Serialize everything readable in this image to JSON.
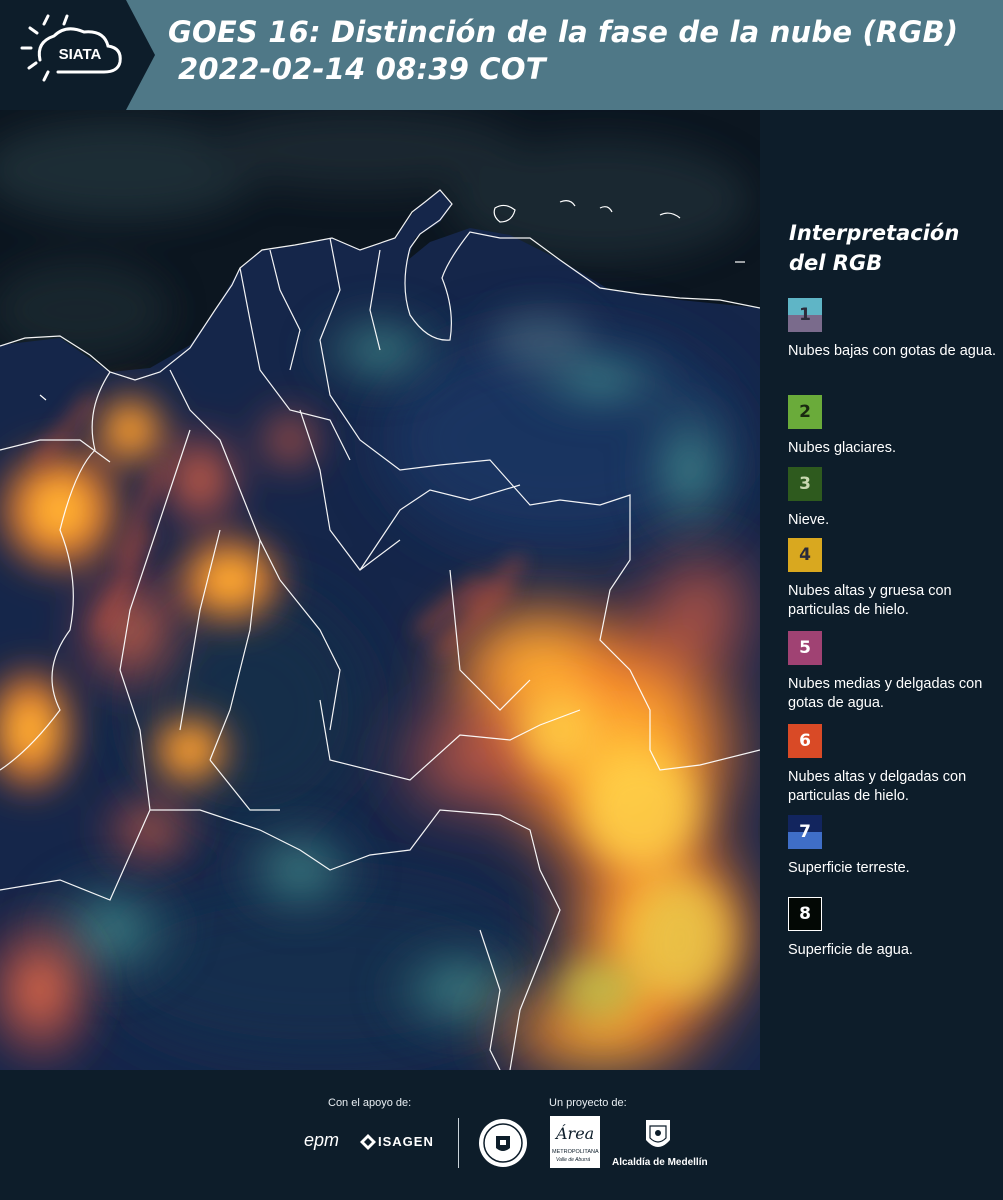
{
  "header": {
    "logo_text": "SIATA",
    "title_line1": "GOES 16: Distinción de la fase de la nube (RGB)",
    "title_line2": "2022-02-14 08:39 COT",
    "bg_color": "#4f7887"
  },
  "legend": {
    "title": "Interpretación del RGB",
    "items": [
      {
        "number": "1",
        "label": "Nubes bajas con gotas de agua.",
        "color_top": "#5fb5c6",
        "color_bottom": "#7a6b8c"
      },
      {
        "number": "2",
        "label": "Nubes glaciares.",
        "color": "#6aab3a"
      },
      {
        "number": "3",
        "label": "Nieve.",
        "color": "#2e5a1e"
      },
      {
        "number": "4",
        "label": "Nubes altas y gruesa con particulas de hielo.",
        "color": "#d9a81f"
      },
      {
        "number": "5",
        "label": "Nubes medias y delgadas con gotas de agua.",
        "color": "#a04273"
      },
      {
        "number": "6",
        "label": "Nubes altas y delgadas con particulas de hielo.",
        "color": "#d94a26"
      },
      {
        "number": "7",
        "label": "Superficie terreste.",
        "color_top": "#12255e",
        "color_bottom": "#3f6ec7"
      },
      {
        "number": "8",
        "label": "Superficie de agua.",
        "color": "#030805"
      }
    ]
  },
  "footer": {
    "support_caption": "Con el apoyo de:",
    "project_caption": "Un proyecto de:",
    "epm_label": "epm",
    "isagen_label": "ISAGEN",
    "area_label": "Área",
    "area_sub1": "METROPOLITANA",
    "area_sub2": "Valle de Aburrá",
    "alcaldia_label": "Alcaldía de Medellín"
  }
}
